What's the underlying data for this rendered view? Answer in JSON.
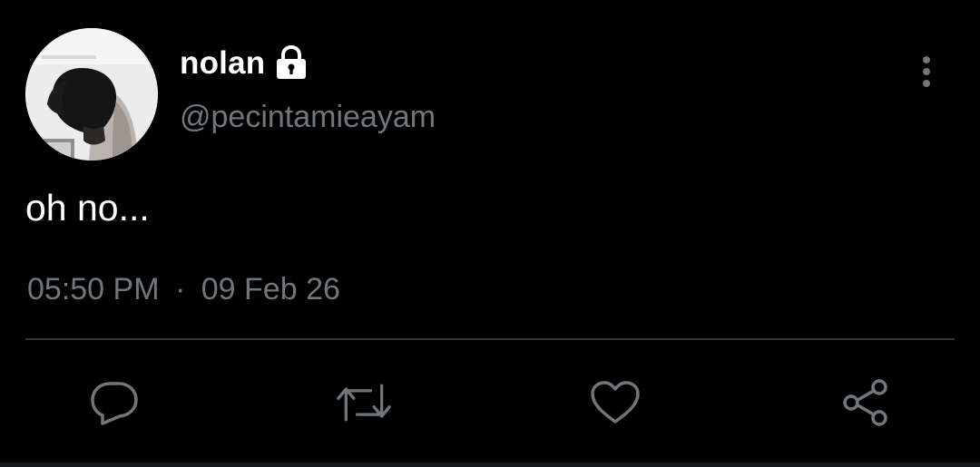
{
  "user": {
    "display_name": "nolan",
    "handle": "@pecintamieayam",
    "protected": true
  },
  "tweet": {
    "text": "oh no...",
    "time": "05:50 PM",
    "separator": "·",
    "date": "09 Feb 26"
  },
  "actions": [
    "reply-icon",
    "retweet-icon",
    "like-icon",
    "share-icon"
  ],
  "colors": {
    "background": "#000000",
    "primary_text": "#ffffff",
    "secondary_text": "#71767b",
    "divider": "#2f3336"
  }
}
